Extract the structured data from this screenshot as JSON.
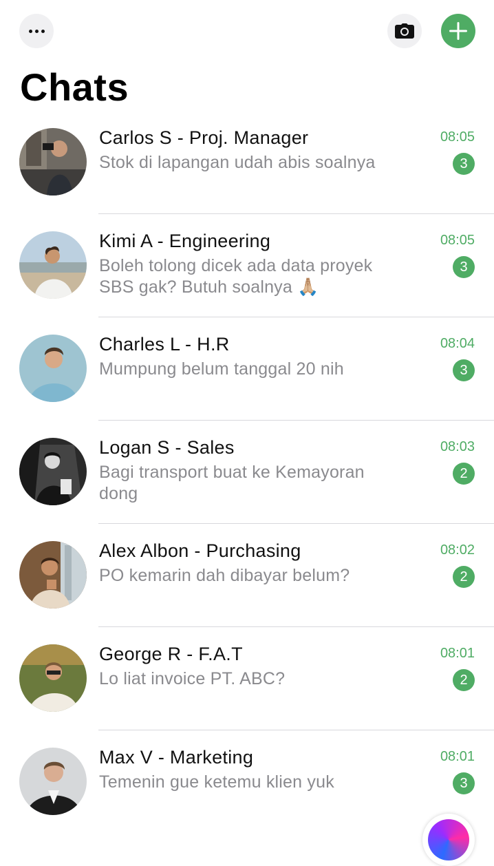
{
  "header": {
    "title": "Chats",
    "more_icon": "ellipsis-icon",
    "camera_icon": "camera-icon",
    "add_icon": "plus-icon",
    "accent_color": "#4fac64"
  },
  "chats": [
    {
      "name": "Carlos S - Proj. Manager",
      "preview": "Stok di lapangan udah abis soalnya",
      "time": "08:05",
      "unread": "3"
    },
    {
      "name": "Kimi A - Engineering",
      "preview": "Boleh tolong dicek ada data proyek SBS gak? Butuh soalnya 🙏🏼",
      "time": "08:05",
      "unread": "3"
    },
    {
      "name": "Charles L - H.R",
      "preview": "Mumpung belum tanggal 20 nih",
      "time": "08:04",
      "unread": "3"
    },
    {
      "name": "Logan S - Sales",
      "preview": "Bagi transport buat ke Kemayoran dong",
      "time": "08:03",
      "unread": "2"
    },
    {
      "name": "Alex Albon - Purchasing",
      "preview": "PO kemarin dah dibayar belum?",
      "time": "08:02",
      "unread": "2"
    },
    {
      "name": "George R - F.A.T",
      "preview": "Lo liat invoice PT. ABC?",
      "time": "08:01",
      "unread": "2"
    },
    {
      "name": "Max V - Marketing",
      "preview": "Temenin gue ketemu klien yuk",
      "time": "08:01",
      "unread": "3"
    }
  ]
}
